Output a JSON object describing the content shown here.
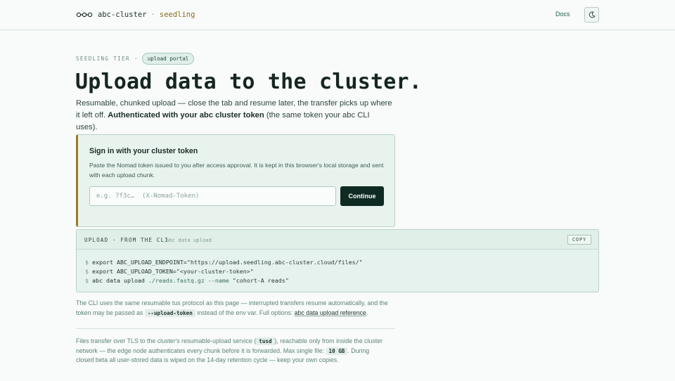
{
  "header": {
    "brand_name": "abc-cluster",
    "brand_separator": "·",
    "brand_tier": "seedling",
    "docs_label": "Docs",
    "logo_icon": "linked-nodes-icon",
    "theme_icon": "moon-icon"
  },
  "hero": {
    "eyebrow": "SEEDLING TIER",
    "eyebrow_dot": "·",
    "pill": "upload portal",
    "title": "Upload data to the cluster.",
    "lead_part1": "Resumable, chunked upload — close the tab and resume later, the transfer picks up where it left off. ",
    "lead_bold": "Authenticated with your abc cluster token",
    "lead_part2": " (the same token your ",
    "lead_cli": "abc",
    "lead_part3": " CLI uses)."
  },
  "signin": {
    "title": "Sign in with your cluster token",
    "description": "Paste the Nomad token issued to you after access approval. It is kept in this browser's local storage and sent with each upload chunk.",
    "input_placeholder": "e.g. 7f3c…  (X-Nomad-Token)",
    "input_value": "",
    "button_label": "Continue"
  },
  "cli": {
    "label": "UPLOAD · FROM THE CLI",
    "command_hint": "abc data upload",
    "copy_label": "COPY",
    "prompt": "$",
    "line1_cmd": "export ABC_UPLOAD_ENDPOINT=",
    "line1_val": "\"https://upload.seedling.abc-cluster.cloud/files/\"",
    "line2_cmd": "export ABC_UPLOAD_TOKEN=",
    "line2_val": "\"<your-cluster-token>\"",
    "line3_cmd": "abc data upload ",
    "line3_path": "./reads.fastq.gz",
    "line3_flag": " --name ",
    "line3_val": "\"cohort-A reads\""
  },
  "notes": {
    "note1_part1": "The CLI uses the same resumable tus protocol as this page — interrupted transfers resume automatically, and the token may be passed as ",
    "note1_chip": "--upload-token",
    "note1_part2": " instead of the env var. Full options: ",
    "note1_link": "abc data upload reference",
    "note1_end": ".",
    "note2_part1": "Files transfer over TLS to the cluster's resumable-upload service (",
    "note2_chip1": "tusd",
    "note2_part2": "), reachable only from inside the cluster network — the edge node authenticates every chunk before it is forwarded. Max single file: ",
    "note2_chip2": "10 GB",
    "note2_part3": ". During closed beta all user-stored data is wiped on the 14-day retention cycle — keep your own copies."
  },
  "colors": {
    "background": "#f8fbf9",
    "accent_dark": "#0f2a23",
    "accent_gold": "#9a7b28",
    "panel": "#e8f3ee"
  }
}
